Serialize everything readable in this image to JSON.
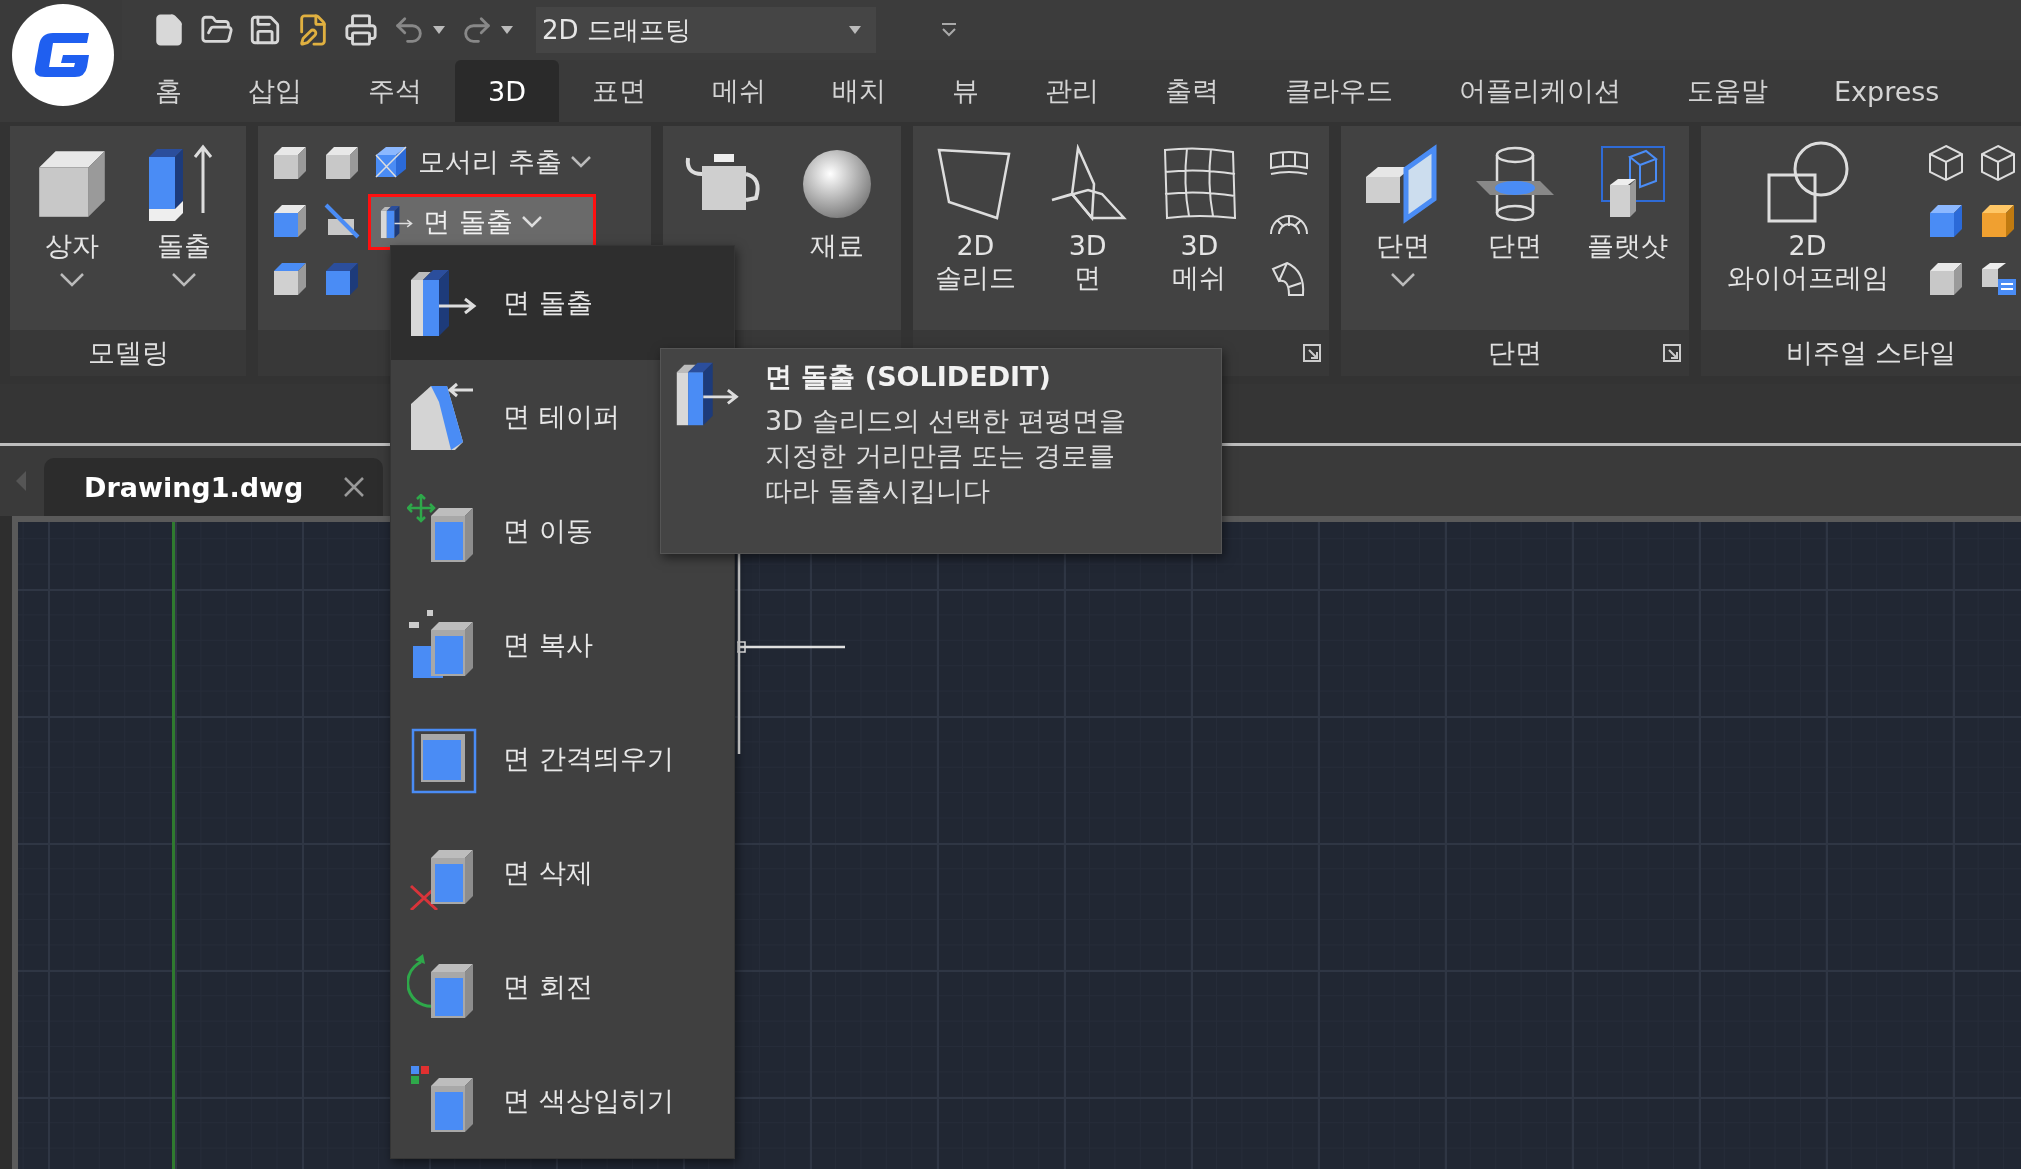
{
  "quick_access": {
    "workspace": "2D 드래프팅"
  },
  "ribbon_tabs": [
    {
      "label": "홈",
      "selected": false
    },
    {
      "label": "삽입",
      "selected": false
    },
    {
      "label": "주석",
      "selected": false
    },
    {
      "label": "3D",
      "selected": true
    },
    {
      "label": "표면",
      "selected": false
    },
    {
      "label": "메쉬",
      "selected": false
    },
    {
      "label": "배치",
      "selected": false
    },
    {
      "label": "뷰",
      "selected": false
    },
    {
      "label": "관리",
      "selected": false
    },
    {
      "label": "출력",
      "selected": false
    },
    {
      "label": "클라우드",
      "selected": false
    },
    {
      "label": "어플리케이션",
      "selected": false
    },
    {
      "label": "도움말",
      "selected": false
    },
    {
      "label": "Express",
      "selected": false
    }
  ],
  "panels": [
    {
      "kind": "modeling",
      "title": "모델링",
      "tools": [
        {
          "label": "상자",
          "dropdown": true
        },
        {
          "label": "돌출",
          "dropdown": true
        }
      ]
    },
    {
      "kind": "solid_edit",
      "edge_button": {
        "label": "모서리 추출"
      },
      "face_button": {
        "label": "면 돌출",
        "highlighted": true
      }
    },
    {
      "kind": "render",
      "tools": [
        {
          "label": "재료"
        }
      ]
    },
    {
      "kind": "mesh",
      "launcher": true,
      "tools": [
        {
          "label": "2D\n솔리드"
        },
        {
          "label": "3D\n면"
        },
        {
          "label": "3D\n메쉬"
        }
      ]
    },
    {
      "kind": "section",
      "title": "단면",
      "launcher": true,
      "tools": [
        {
          "label": "단면",
          "dropdown": true
        },
        {
          "label": "단면"
        },
        {
          "label": "플랫샷"
        }
      ]
    },
    {
      "kind": "visual",
      "title": "비주얼 스타일",
      "tools": [
        {
          "label": "2D\n와이어프레임"
        }
      ]
    }
  ],
  "document_tabs": [
    {
      "label": "Drawing1.dwg",
      "selected": true
    }
  ],
  "face_menu": {
    "items": [
      {
        "label": "면 돌출",
        "selected": true
      },
      {
        "label": "면 테이퍼",
        "selected": false
      },
      {
        "label": "면 이동",
        "selected": false
      },
      {
        "label": "면 복사",
        "selected": false
      },
      {
        "label": "면 간격띄우기",
        "selected": false
      },
      {
        "label": "면 삭제",
        "selected": false
      },
      {
        "label": "면 회전",
        "selected": false
      },
      {
        "label": "면 색상입히기",
        "selected": false
      }
    ]
  },
  "tooltip": {
    "title": "면 돌출 (SOLIDEDIT)",
    "description": "3D 솔리드의 선택한 편평면을\n지정한 거리만큼 또는 경로를\n따라 돌출시킵니다"
  }
}
